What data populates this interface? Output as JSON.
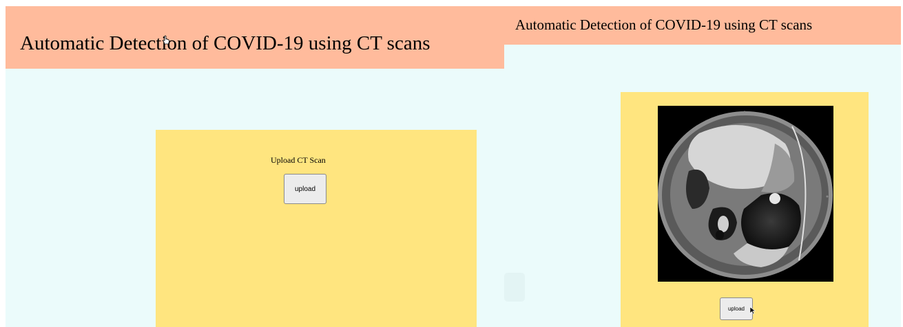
{
  "left_view": {
    "header": {
      "title": "Automatic Detection of COVID-19 using CT scans"
    },
    "card": {
      "upload_label": "Upload CT Scan",
      "upload_button": "upload",
      "cursor": "hand-pointer-icon"
    }
  },
  "right_view": {
    "header": {
      "title": "Automatic Detection of COVID-19 using CT scans"
    },
    "card": {
      "scan_image": "ct-scan-image",
      "upload_button": "upload",
      "cursor": "arrow-pointer-icon"
    }
  },
  "colors": {
    "header_bg": "#ffbb9c",
    "page_bg": "#ebfbfb",
    "card_bg": "#ffe57f",
    "button_bg": "#ececec"
  }
}
